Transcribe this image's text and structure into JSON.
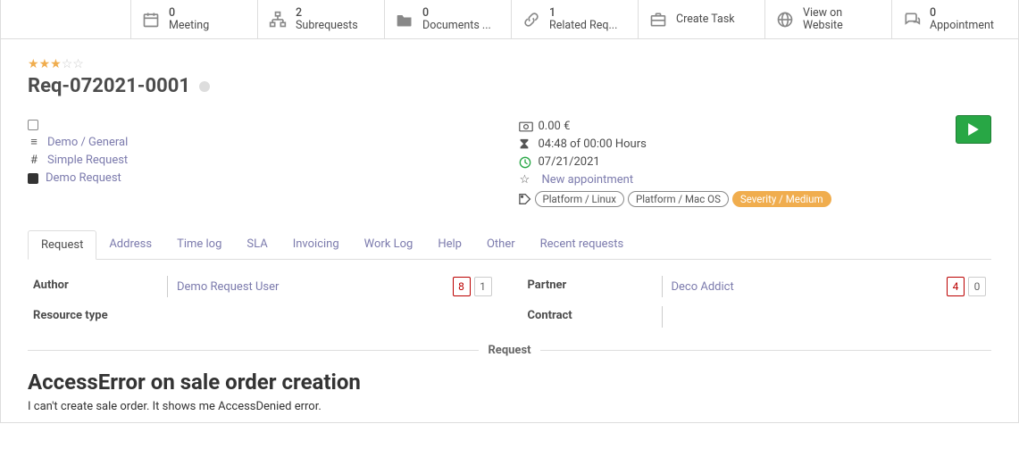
{
  "statbar": {
    "meeting": {
      "count": "0",
      "label": "Meeting"
    },
    "subreq": {
      "count": "2",
      "label": "Subrequests"
    },
    "docs": {
      "count": "0",
      "label": "Documents ..."
    },
    "related": {
      "count": "1",
      "label": "Related Req..."
    },
    "task": {
      "label": "Create Task"
    },
    "website": {
      "line1": "View on",
      "line2": "Website"
    },
    "appt": {
      "count": "0",
      "label": "Appointment"
    }
  },
  "title": "Req-072021-0001",
  "breadcrumbs": {
    "category": "Demo / General",
    "type": "Simple Request",
    "kind": "Demo Request"
  },
  "right": {
    "money": "0.00 €",
    "time": "04:48 of 00:00 Hours",
    "date": "07/21/2021",
    "new_appt": "New appointment",
    "tag1": "Platform / Linux",
    "tag2": "Platform / Mac OS",
    "tag3": "Severity / Medium"
  },
  "tabs": {
    "request": "Request",
    "address": "Address",
    "timelog": "Time log",
    "sla": "SLA",
    "invoicing": "Invoicing",
    "worklog": "Work Log",
    "help": "Help",
    "other": "Other",
    "recent": "Recent requests"
  },
  "fields": {
    "author_label": "Author",
    "author_value": "Demo Request User",
    "author_c1": "8",
    "author_c2": "1",
    "restype_label": "Resource type",
    "partner_label": "Partner",
    "partner_value": "Deco Addict",
    "partner_c1": "4",
    "partner_c2": "0",
    "contract_label": "Contract"
  },
  "section_title": "Request",
  "request_title": "AccessError on sale order creation",
  "request_body": "I can't create sale order. It shows me AccessDenied error."
}
